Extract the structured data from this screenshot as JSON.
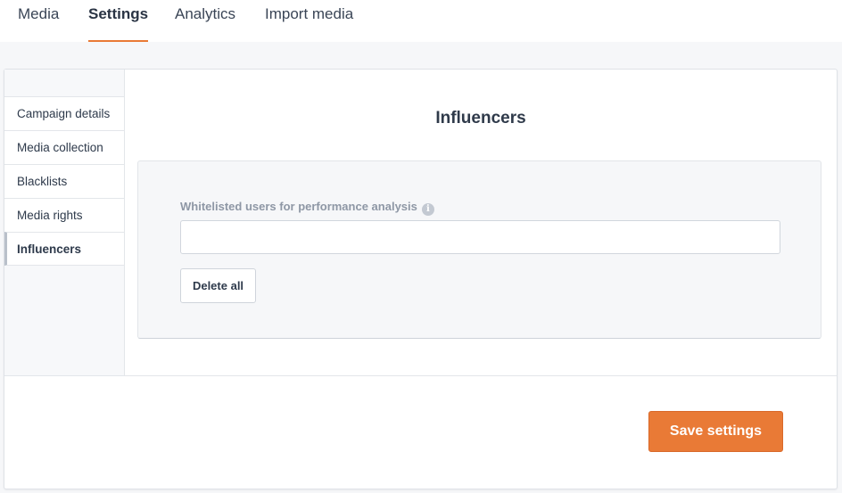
{
  "top_tabs": [
    {
      "label": "Media"
    },
    {
      "label": "Settings",
      "active": true
    },
    {
      "label": "Analytics"
    },
    {
      "label": "Import media"
    }
  ],
  "sidebar": {
    "items": [
      {
        "label": "Campaign details"
      },
      {
        "label": "Media collection"
      },
      {
        "label": "Blacklists"
      },
      {
        "label": "Media rights"
      },
      {
        "label": "Influencers",
        "active": true
      }
    ]
  },
  "main": {
    "heading": "Influencers",
    "whitelist": {
      "label": "Whitelisted users for performance analysis",
      "info_icon": "info-icon",
      "value": "",
      "placeholder": ""
    },
    "delete_all_label": "Delete all"
  },
  "footer": {
    "save_label": "Save settings"
  },
  "colors": {
    "accent": "#e97a36",
    "text": "#2e3a4b",
    "muted_label": "#8e97a5"
  }
}
